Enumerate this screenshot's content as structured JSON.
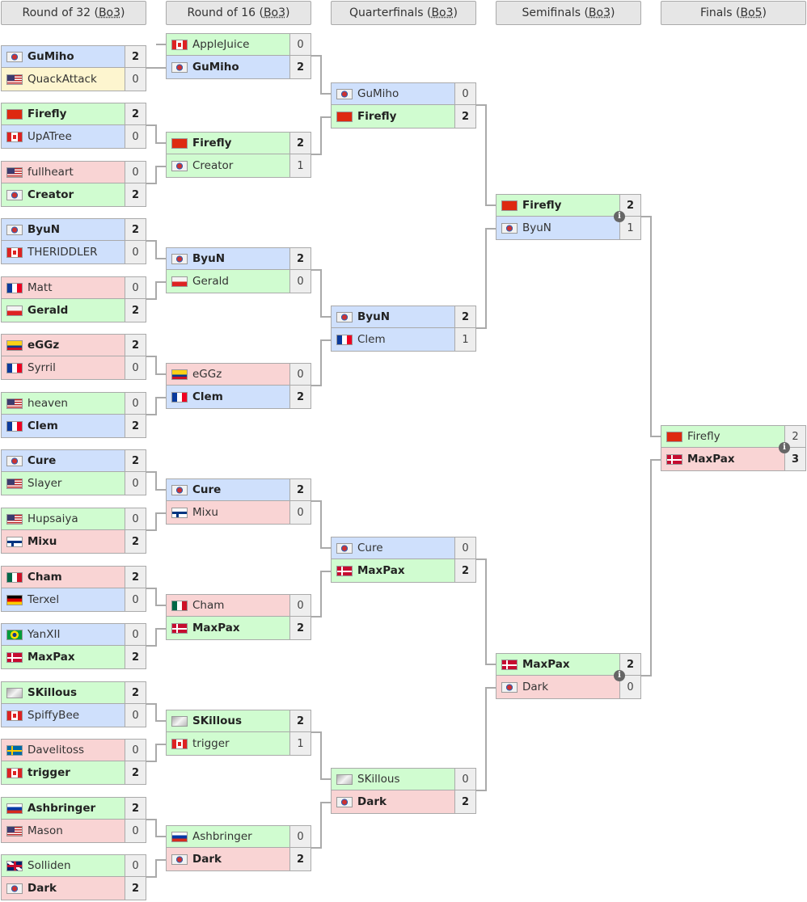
{
  "palette": {
    "blue": "#cfe0fc",
    "green": "#d0fcd0",
    "red": "#f9d4d4",
    "yellow": "#fdf5cf"
  },
  "rounds": [
    {
      "title": "Round of 32",
      "format": "Bo3",
      "matches": [
        [
          {
            "name": "GuMiho",
            "flag": "kr",
            "color": "blue",
            "score": "2",
            "winner": true
          },
          {
            "name": "QuackAttack",
            "flag": "us",
            "color": "yellow",
            "score": "0"
          }
        ],
        [
          {
            "name": "Firefly",
            "flag": "cn",
            "color": "green",
            "score": "2",
            "winner": true
          },
          {
            "name": "UpATree",
            "flag": "ca",
            "color": "blue",
            "score": "0"
          }
        ],
        [
          {
            "name": "fullheart",
            "flag": "us",
            "color": "red",
            "score": "0"
          },
          {
            "name": "Creator",
            "flag": "kr",
            "color": "green",
            "score": "2",
            "winner": true
          }
        ],
        [
          {
            "name": "ByuN",
            "flag": "kr",
            "color": "blue",
            "score": "2",
            "winner": true
          },
          {
            "name": "THERIDDLER",
            "flag": "ca",
            "color": "blue",
            "score": "0"
          }
        ],
        [
          {
            "name": "Matt",
            "flag": "fr",
            "color": "red",
            "score": "0"
          },
          {
            "name": "Gerald",
            "flag": "pl",
            "color": "green",
            "score": "2",
            "winner": true
          }
        ],
        [
          {
            "name": "eGGz",
            "flag": "co",
            "color": "red",
            "score": "2",
            "winner": true
          },
          {
            "name": "Syrril",
            "flag": "fr",
            "color": "red",
            "score": "0"
          }
        ],
        [
          {
            "name": "heaven",
            "flag": "us",
            "color": "green",
            "score": "0"
          },
          {
            "name": "Clem",
            "flag": "fr",
            "color": "blue",
            "score": "2",
            "winner": true
          }
        ],
        [
          {
            "name": "Cure",
            "flag": "kr",
            "color": "blue",
            "score": "2",
            "winner": true
          },
          {
            "name": "Slayer",
            "flag": "us",
            "color": "green",
            "score": "0"
          }
        ],
        [
          {
            "name": "Hupsaiya",
            "flag": "us",
            "color": "green",
            "score": "0"
          },
          {
            "name": "Mixu",
            "flag": "fi",
            "color": "red",
            "score": "2",
            "winner": true
          }
        ],
        [
          {
            "name": "Cham",
            "flag": "mx",
            "color": "red",
            "score": "2",
            "winner": true
          },
          {
            "name": "Terxel",
            "flag": "de",
            "color": "blue",
            "score": "0"
          }
        ],
        [
          {
            "name": "YanXII",
            "flag": "br",
            "color": "blue",
            "score": "0"
          },
          {
            "name": "MaxPax",
            "flag": "dk",
            "color": "green",
            "score": "2",
            "winner": true
          }
        ],
        [
          {
            "name": "SKillous",
            "flag": "xx",
            "color": "green",
            "score": "2",
            "winner": true
          },
          {
            "name": "SpiffyBee",
            "flag": "ca",
            "color": "blue",
            "score": "0"
          }
        ],
        [
          {
            "name": "Davelitoss",
            "flag": "se",
            "color": "red",
            "score": "0"
          },
          {
            "name": "trigger",
            "flag": "ca",
            "color": "green",
            "score": "2",
            "winner": true
          }
        ],
        [
          {
            "name": "Ashbringer",
            "flag": "ru",
            "color": "green",
            "score": "2",
            "winner": true
          },
          {
            "name": "Mason",
            "flag": "us",
            "color": "red",
            "score": "0"
          }
        ],
        [
          {
            "name": "Solliden",
            "flag": "gb",
            "color": "green",
            "score": "0"
          },
          {
            "name": "Dark",
            "flag": "kr",
            "color": "red",
            "score": "2",
            "winner": true
          }
        ]
      ]
    },
    {
      "title": "Round of 16",
      "format": "Bo3",
      "matches": [
        [
          {
            "name": "AppleJuice",
            "flag": "ca",
            "color": "green",
            "score": "0"
          },
          {
            "name": "GuMiho",
            "flag": "kr",
            "color": "blue",
            "score": "2",
            "winner": true
          }
        ],
        [
          {
            "name": "Firefly",
            "flag": "cn",
            "color": "green",
            "score": "2",
            "winner": true
          },
          {
            "name": "Creator",
            "flag": "kr",
            "color": "green",
            "score": "1"
          }
        ],
        [
          {
            "name": "ByuN",
            "flag": "kr",
            "color": "blue",
            "score": "2",
            "winner": true
          },
          {
            "name": "Gerald",
            "flag": "pl",
            "color": "green",
            "score": "0"
          }
        ],
        [
          {
            "name": "eGGz",
            "flag": "co",
            "color": "red",
            "score": "0"
          },
          {
            "name": "Clem",
            "flag": "fr",
            "color": "blue",
            "score": "2",
            "winner": true
          }
        ],
        [
          {
            "name": "Cure",
            "flag": "kr",
            "color": "blue",
            "score": "2",
            "winner": true
          },
          {
            "name": "Mixu",
            "flag": "fi",
            "color": "red",
            "score": "0"
          }
        ],
        [
          {
            "name": "Cham",
            "flag": "mx",
            "color": "red",
            "score": "0"
          },
          {
            "name": "MaxPax",
            "flag": "dk",
            "color": "green",
            "score": "2",
            "winner": true
          }
        ],
        [
          {
            "name": "SKillous",
            "flag": "xx",
            "color": "green",
            "score": "2",
            "winner": true
          },
          {
            "name": "trigger",
            "flag": "ca",
            "color": "green",
            "score": "1"
          }
        ],
        [
          {
            "name": "Ashbringer",
            "flag": "ru",
            "color": "green",
            "score": "0"
          },
          {
            "name": "Dark",
            "flag": "kr",
            "color": "red",
            "score": "2",
            "winner": true
          }
        ]
      ]
    },
    {
      "title": "Quarterfinals",
      "format": "Bo3",
      "matches": [
        [
          {
            "name": "GuMiho",
            "flag": "kr",
            "color": "blue",
            "score": "0"
          },
          {
            "name": "Firefly",
            "flag": "cn",
            "color": "green",
            "score": "2",
            "winner": true
          }
        ],
        [
          {
            "name": "ByuN",
            "flag": "kr",
            "color": "blue",
            "score": "2",
            "winner": true
          },
          {
            "name": "Clem",
            "flag": "fr",
            "color": "blue",
            "score": "1"
          }
        ],
        [
          {
            "name": "Cure",
            "flag": "kr",
            "color": "blue",
            "score": "0"
          },
          {
            "name": "MaxPax",
            "flag": "dk",
            "color": "green",
            "score": "2",
            "winner": true
          }
        ],
        [
          {
            "name": "SKillous",
            "flag": "xx",
            "color": "green",
            "score": "0"
          },
          {
            "name": "Dark",
            "flag": "kr",
            "color": "red",
            "score": "2",
            "winner": true
          }
        ]
      ]
    },
    {
      "title": "Semifinals",
      "format": "Bo3",
      "info": true,
      "matches": [
        [
          {
            "name": "Firefly",
            "flag": "cn",
            "color": "green",
            "score": "2",
            "winner": true
          },
          {
            "name": "ByuN",
            "flag": "kr",
            "color": "blue",
            "score": "1"
          }
        ],
        [
          {
            "name": "MaxPax",
            "flag": "dk",
            "color": "green",
            "score": "2",
            "winner": true
          },
          {
            "name": "Dark",
            "flag": "kr",
            "color": "red",
            "score": "0"
          }
        ]
      ]
    },
    {
      "title": "Finals",
      "format": "Bo5",
      "info": true,
      "matches": [
        [
          {
            "name": "Firefly",
            "flag": "cn",
            "color": "green",
            "score": "2"
          },
          {
            "name": "MaxPax",
            "flag": "dk",
            "color": "red",
            "score": "3",
            "winner": true
          }
        ]
      ]
    }
  ]
}
